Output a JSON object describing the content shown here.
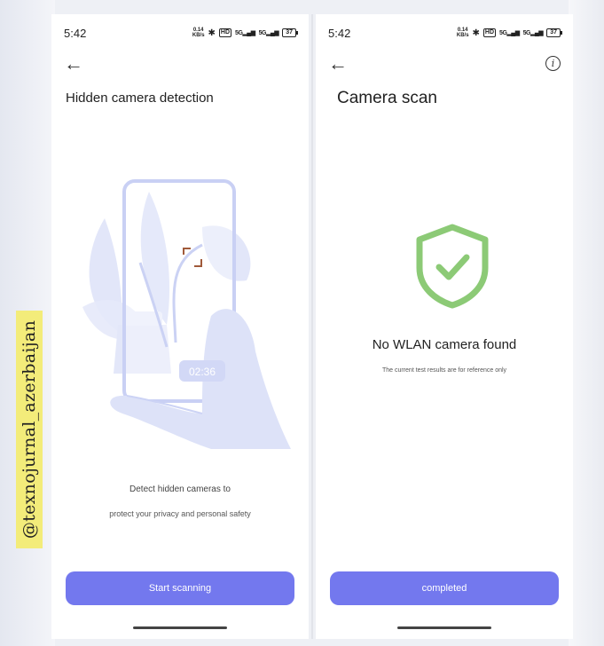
{
  "watermark": "@texnojurnal_azerbaijan",
  "colors": {
    "accent": "#7378ee",
    "shield": "#8cca76",
    "illustration": "#c6cdf3"
  },
  "status_bar": {
    "time": "5:42",
    "speed_top": "0.14",
    "speed_bottom": "KB/s",
    "hd": "HD",
    "signal1": "5G",
    "signal2": "5G",
    "battery": "37"
  },
  "left": {
    "title": "Hidden camera detection",
    "timer": "02:36",
    "description_line1": "Detect hidden cameras to",
    "description_line2": "protect your privacy and personal safety",
    "button_label": "Start scanning"
  },
  "right": {
    "title": "Camera scan",
    "result": "No WLAN camera found",
    "note": "The current test results are for reference only",
    "button_label": "completed"
  }
}
